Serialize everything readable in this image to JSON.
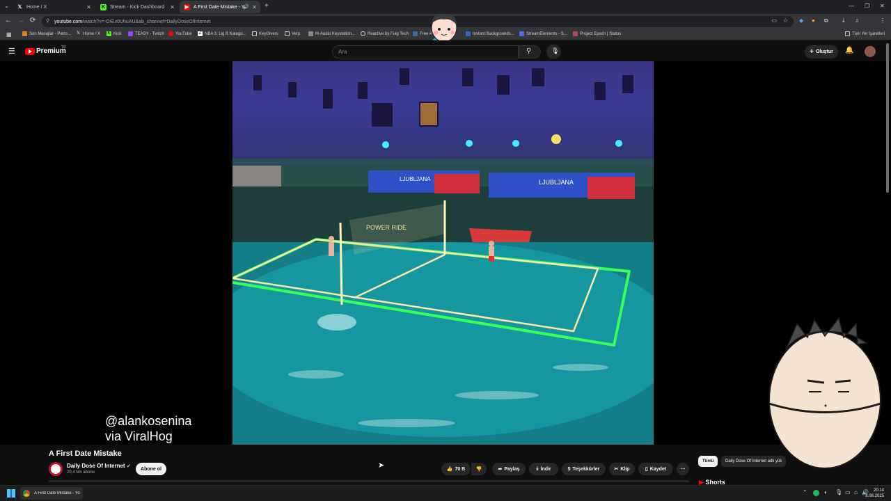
{
  "browser": {
    "tabs": [
      {
        "label": "Home / X",
        "icon": "x-icon"
      },
      {
        "label": "Stream - Kick Dashboard",
        "icon": "kick-icon"
      },
      {
        "label": "A First Date Mistake - YouT",
        "icon": "youtube-icon"
      }
    ],
    "address": {
      "host": "youtube.com",
      "path": "/watch?v=-OrEv0UhuAU&ab_channel=DailyDoseOfInternet"
    },
    "bookmarks": [
      "Son Mesajlar - Patro...",
      "Home / X",
      "Kick",
      "TEASY - Twitch",
      "YouTube",
      "NBA 3. Lig B Katego...",
      "KeyGivers",
      "Verp",
      "M-Audio Keystation...",
      "Reactive by Fuig Tech",
      "Free A",
      "Instant Backgrounds...",
      "StreamElements - S...",
      "Project Epoch | Status"
    ],
    "other_bookmarks": "Tüm Yer İşaretleri"
  },
  "youtube": {
    "brand": "Premium",
    "region": "TR",
    "search_placeholder": "Ara",
    "create_label": "Oluştur"
  },
  "video": {
    "credit_line1": "@alankosenina",
    "credit_line2": "via ViralHog",
    "banner_text_1": "LJUBLJANA",
    "banner_text_2": "LJUBLJANA",
    "net_text": "POWER RIDE"
  },
  "meta": {
    "title": "A First Date Mistake",
    "channel": "Daily Dose Of Internet",
    "subscribers": "20,4 Mn abone",
    "subscribe_label": "Abone ol",
    "likes": "70 B",
    "share": "Paylaş",
    "download": "İndir",
    "thanks": "Teşekkürler",
    "clip": "Klip",
    "save": "Kaydet"
  },
  "sidebar": {
    "chip_all": "Tümü",
    "chip_channel": "Daily Dose Of Internet adlı yük",
    "shorts": "Shorts"
  },
  "taskbar": {
    "task_label": "A First Date Mistake - Yo",
    "time": "20:14",
    "date": "8.08.2025"
  },
  "colors": {
    "youtube_red": "#ff0000",
    "accent_green": "#39ff5a",
    "pool_cyan": "#19a3ab"
  }
}
